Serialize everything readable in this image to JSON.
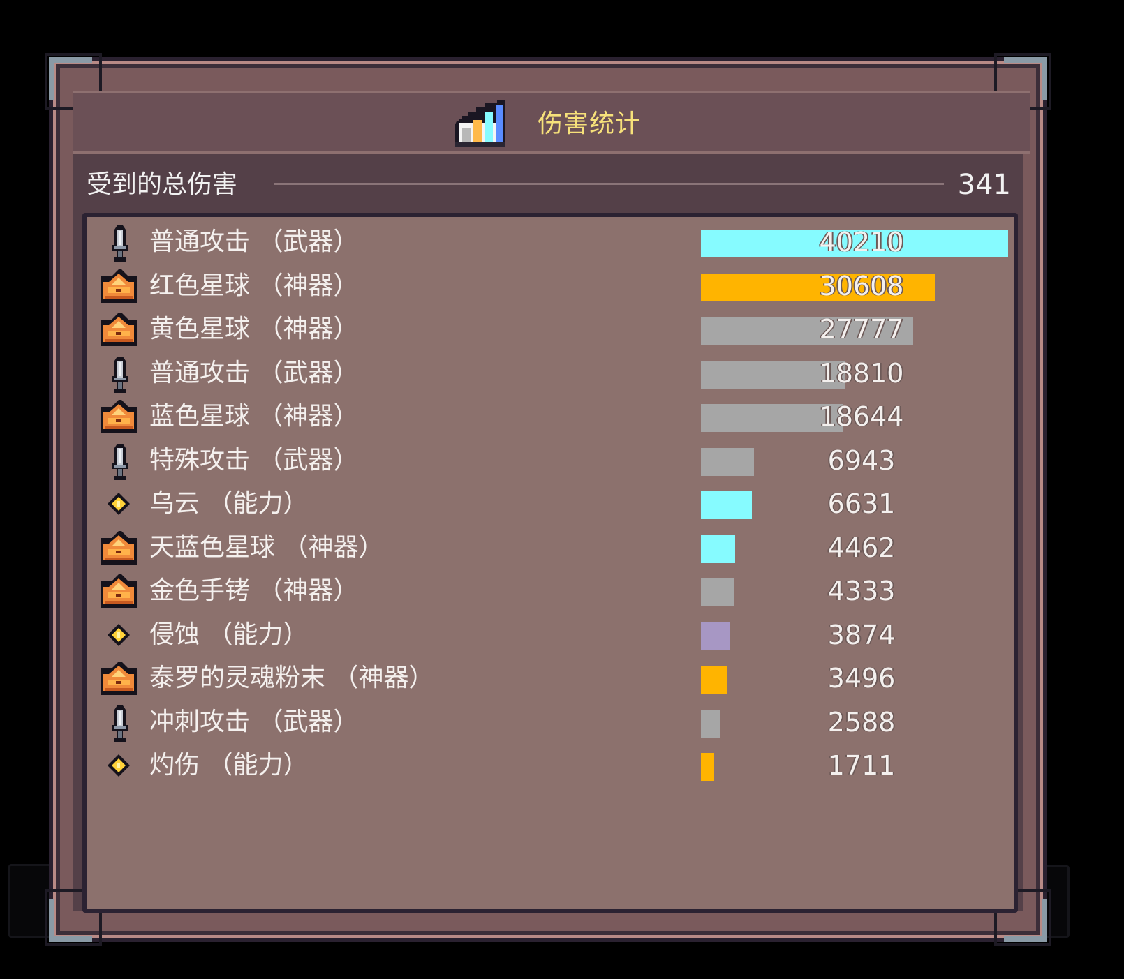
{
  "title": "伤害统计",
  "total": {
    "label": "受到的总伤害",
    "value": "341"
  },
  "max_value": 40210,
  "colors": {
    "cyan": "#86fbff",
    "orange": "#ffb400",
    "gray": "#a6a6a6",
    "purple": "#a797c4",
    "title_text": "#f7e17a"
  },
  "rows": [
    {
      "label": "普通攻击 （武器）",
      "value": "40210",
      "amount": 40210,
      "color": "#86fbff",
      "icon": "sword-icon"
    },
    {
      "label": "红色星球 （神器）",
      "value": "30608",
      "amount": 30608,
      "color": "#ffb400",
      "icon": "artifact-icon"
    },
    {
      "label": "黄色星球 （神器）",
      "value": "27777",
      "amount": 27777,
      "color": "#a6a6a6",
      "icon": "artifact-icon"
    },
    {
      "label": "普通攻击 （武器）",
      "value": "18810",
      "amount": 18810,
      "color": "#a6a6a6",
      "icon": "sword-icon"
    },
    {
      "label": "蓝色星球 （神器）",
      "value": "18644",
      "amount": 18644,
      "color": "#a6a6a6",
      "icon": "artifact-icon"
    },
    {
      "label": "特殊攻击 （武器）",
      "value": "6943",
      "amount": 6943,
      "color": "#a6a6a6",
      "icon": "sword-icon"
    },
    {
      "label": "乌云 （能力）",
      "value": "6631",
      "amount": 6631,
      "color": "#86fbff",
      "icon": "ability-icon"
    },
    {
      "label": "天蓝色星球 （神器）",
      "value": "4462",
      "amount": 4462,
      "color": "#86fbff",
      "icon": "artifact-icon"
    },
    {
      "label": "金色手铐 （神器）",
      "value": "4333",
      "amount": 4333,
      "color": "#a6a6a6",
      "icon": "artifact-icon"
    },
    {
      "label": "侵蚀 （能力）",
      "value": "3874",
      "amount": 3874,
      "color": "#a797c4",
      "icon": "ability-icon"
    },
    {
      "label": "泰罗的灵魂粉末 （神器）",
      "value": "3496",
      "amount": 3496,
      "color": "#ffb400",
      "icon": "artifact-icon"
    },
    {
      "label": "冲刺攻击 （武器）",
      "value": "2588",
      "amount": 2588,
      "color": "#a6a6a6",
      "icon": "sword-icon"
    },
    {
      "label": "灼伤 （能力）",
      "value": "1711",
      "amount": 1711,
      "color": "#ffb400",
      "icon": "ability-icon"
    }
  ]
}
